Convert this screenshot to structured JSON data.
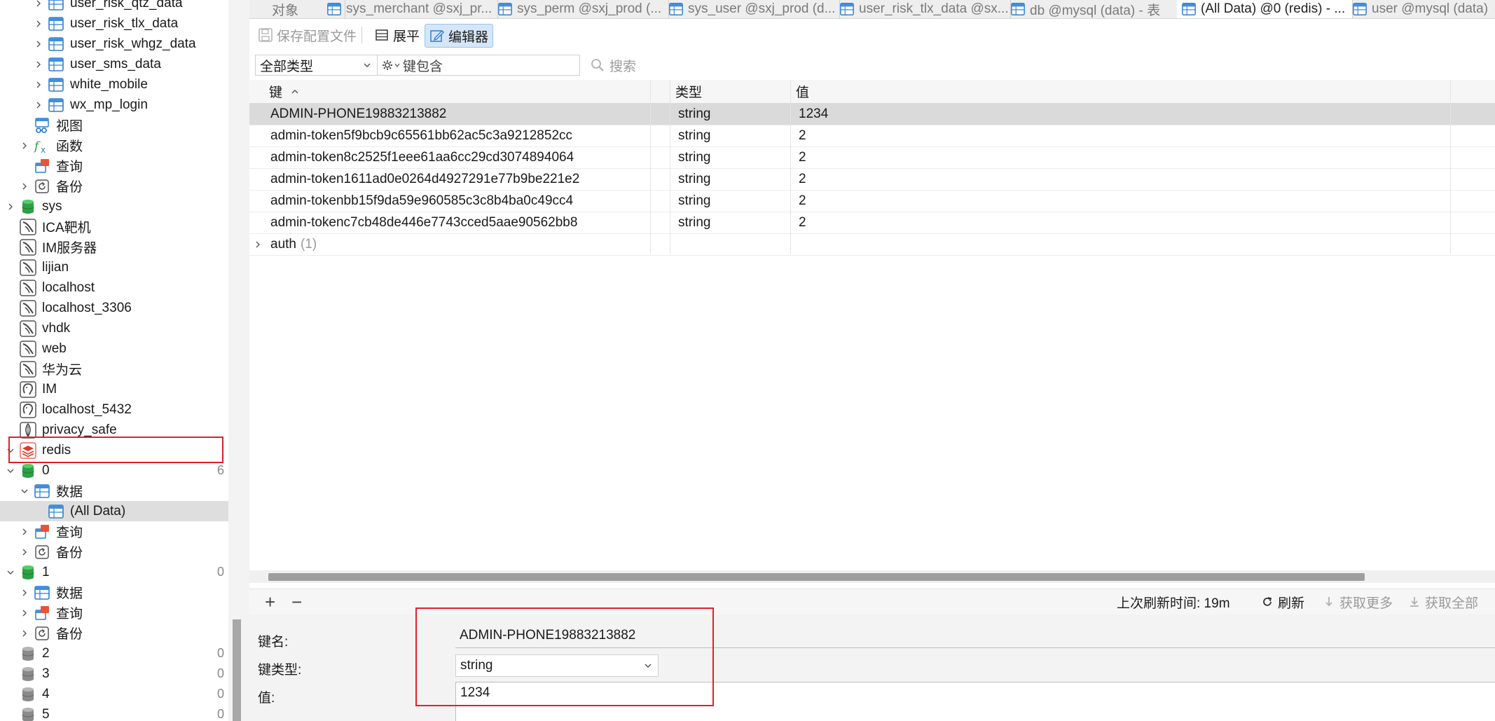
{
  "sidebar": {
    "items": [
      {
        "label": "user_risk_qtz_data",
        "icon": "table-icon",
        "indent": 2,
        "expandable": true,
        "count": "",
        "selected": false
      },
      {
        "label": "user_risk_tlx_data",
        "icon": "table-icon",
        "indent": 2,
        "expandable": true,
        "count": "",
        "selected": false
      },
      {
        "label": "user_risk_whgz_data",
        "icon": "table-icon",
        "indent": 2,
        "expandable": true,
        "count": "",
        "selected": false
      },
      {
        "label": "user_sms_data",
        "icon": "table-icon",
        "indent": 2,
        "expandable": true,
        "count": "",
        "selected": false
      },
      {
        "label": "white_mobile",
        "icon": "table-icon",
        "indent": 2,
        "expandable": true,
        "count": "",
        "selected": false
      },
      {
        "label": "wx_mp_login",
        "icon": "table-icon",
        "indent": 2,
        "expandable": true,
        "count": "",
        "selected": false
      },
      {
        "label": "视图",
        "icon": "view-icon",
        "indent": 1,
        "expandable": false,
        "count": "",
        "selected": false
      },
      {
        "label": "函数",
        "icon": "function-icon",
        "indent": 1,
        "expandable": true,
        "count": "",
        "selected": false
      },
      {
        "label": "查询",
        "icon": "query-icon",
        "indent": 1,
        "expandable": false,
        "count": "",
        "selected": false
      },
      {
        "label": "备份",
        "icon": "backup-icon",
        "indent": 1,
        "expandable": true,
        "count": "",
        "selected": false
      },
      {
        "label": "sys",
        "icon": "database-green-icon",
        "indent": 0,
        "expandable": true,
        "count": "",
        "selected": false
      },
      {
        "label": "ICA靶机",
        "icon": "mysql-connection-icon",
        "indent": 0,
        "expandable": false,
        "count": "",
        "selected": false
      },
      {
        "label": "IM服务器",
        "icon": "mysql-connection-icon",
        "indent": 0,
        "expandable": false,
        "count": "",
        "selected": false
      },
      {
        "label": "lijian",
        "icon": "mysql-connection-icon",
        "indent": 0,
        "expandable": false,
        "count": "",
        "selected": false
      },
      {
        "label": "localhost",
        "icon": "mysql-connection-icon",
        "indent": 0,
        "expandable": false,
        "count": "",
        "selected": false
      },
      {
        "label": "localhost_3306",
        "icon": "mysql-connection-icon",
        "indent": 0,
        "expandable": false,
        "count": "",
        "selected": false
      },
      {
        "label": "vhdk",
        "icon": "mysql-connection-icon",
        "indent": 0,
        "expandable": false,
        "count": "",
        "selected": false
      },
      {
        "label": "web",
        "icon": "mysql-connection-icon",
        "indent": 0,
        "expandable": false,
        "count": "",
        "selected": false
      },
      {
        "label": "华为云",
        "icon": "mysql-connection-icon",
        "indent": 0,
        "expandable": false,
        "count": "",
        "selected": false
      },
      {
        "label": "IM",
        "icon": "postgres-connection-icon",
        "indent": 0,
        "expandable": false,
        "count": "",
        "selected": false
      },
      {
        "label": "localhost_5432",
        "icon": "postgres-connection-icon",
        "indent": 0,
        "expandable": false,
        "count": "",
        "selected": false
      },
      {
        "label": "privacy_safe",
        "icon": "mongodb-connection-icon",
        "indent": 0,
        "expandable": false,
        "count": "",
        "selected": false
      },
      {
        "label": "redis",
        "icon": "redis-connection-icon",
        "indent": 0,
        "expandable": "open",
        "count": "",
        "selected": false
      },
      {
        "label": "0",
        "icon": "database-green-icon",
        "indent": 0,
        "expandable": "open",
        "count": "6",
        "selected": false
      },
      {
        "label": "数据",
        "icon": "table-icon",
        "indent": 1,
        "expandable": "open",
        "count": "",
        "selected": false
      },
      {
        "label": "(All Data)",
        "icon": "table-icon",
        "indent": 2,
        "expandable": false,
        "count": "",
        "selected": true
      },
      {
        "label": "查询",
        "icon": "query-icon",
        "indent": 1,
        "expandable": true,
        "count": "",
        "selected": false
      },
      {
        "label": "备份",
        "icon": "backup-icon",
        "indent": 1,
        "expandable": true,
        "count": "",
        "selected": false
      },
      {
        "label": "1",
        "icon": "database-green-icon",
        "indent": 0,
        "expandable": "open",
        "count": "0",
        "selected": false
      },
      {
        "label": "数据",
        "icon": "table-icon",
        "indent": 1,
        "expandable": true,
        "count": "",
        "selected": false
      },
      {
        "label": "查询",
        "icon": "query-icon",
        "indent": 1,
        "expandable": true,
        "count": "",
        "selected": false
      },
      {
        "label": "备份",
        "icon": "backup-icon",
        "indent": 1,
        "expandable": true,
        "count": "",
        "selected": false
      },
      {
        "label": "2",
        "icon": "database-gray-icon",
        "indent": 0,
        "expandable": false,
        "count": "0",
        "selected": false
      },
      {
        "label": "3",
        "icon": "database-gray-icon",
        "indent": 0,
        "expandable": false,
        "count": "0",
        "selected": false
      },
      {
        "label": "4",
        "icon": "database-gray-icon",
        "indent": 0,
        "expandable": false,
        "count": "0",
        "selected": false
      },
      {
        "label": "5",
        "icon": "database-gray-icon",
        "indent": 0,
        "expandable": false,
        "count": "0",
        "selected": false
      }
    ]
  },
  "tabs": [
    {
      "label": "对象",
      "icon": "",
      "active": false
    },
    {
      "label": "sys_merchant @sxj_pr...",
      "icon": "table-icon",
      "active": false
    },
    {
      "label": "sys_perm @sxj_prod (...",
      "icon": "table-icon",
      "active": false
    },
    {
      "label": "sys_user @sxj_prod (d...",
      "icon": "table-icon",
      "active": false
    },
    {
      "label": "user_risk_tlx_data @sx...",
      "icon": "table-icon",
      "active": false
    },
    {
      "label": "db @mysql (data) - 表",
      "icon": "table-icon",
      "active": false
    },
    {
      "label": "(All Data) @0 (redis) - ...",
      "icon": "table-icon",
      "active": true
    },
    {
      "label": "user @mysql (data)",
      "icon": "table-icon",
      "active": false
    }
  ],
  "toolbar": {
    "save_config": "保存配置文件",
    "flatten": "展平",
    "editor": "编辑器"
  },
  "filter": {
    "type_select": "全部类型",
    "key_contains_placeholder": "键包含",
    "search": "搜索"
  },
  "grid": {
    "columns": [
      "键",
      "类型",
      "值"
    ],
    "rows": [
      {
        "key": "ADMIN-PHONE19883213882",
        "type": "string",
        "value": "1234",
        "selected": true
      },
      {
        "key": "admin-token5f9bcb9c65561bb62ac5c3a9212852cc",
        "type": "string",
        "value": "2",
        "selected": false
      },
      {
        "key": "admin-token8c2525f1eee61aa6cc29cd3074894064",
        "type": "string",
        "value": "2",
        "selected": false
      },
      {
        "key": "admin-token1611ad0e0264d4927291e77b9be221e2",
        "type": "string",
        "value": "2",
        "selected": false
      },
      {
        "key": "admin-tokenbb15f9da59e960585c3c8b4ba0c49cc4",
        "type": "string",
        "value": "2",
        "selected": false
      },
      {
        "key": "admin-tokenc7cb48de446e7743cced5aae90562bb8",
        "type": "string",
        "value": "2",
        "selected": false
      }
    ],
    "group_row": {
      "label": "auth",
      "count": "(1)"
    }
  },
  "footer": {
    "add": "+",
    "remove": "−",
    "last_refresh": "上次刷新时间: 19m",
    "refresh": "刷新",
    "fetch_more": "获取更多",
    "fetch_all": "获取全部"
  },
  "detail": {
    "key_name_label": "键名:",
    "key_name_value": "ADMIN-PHONE19883213882",
    "key_type_label": "键类型:",
    "key_type_value": "string",
    "value_label": "值:",
    "value_value": "1234"
  },
  "colors": {
    "highlight": "#e0202a",
    "selection": "#dadada",
    "accent_blue": "#2f7fd1"
  }
}
